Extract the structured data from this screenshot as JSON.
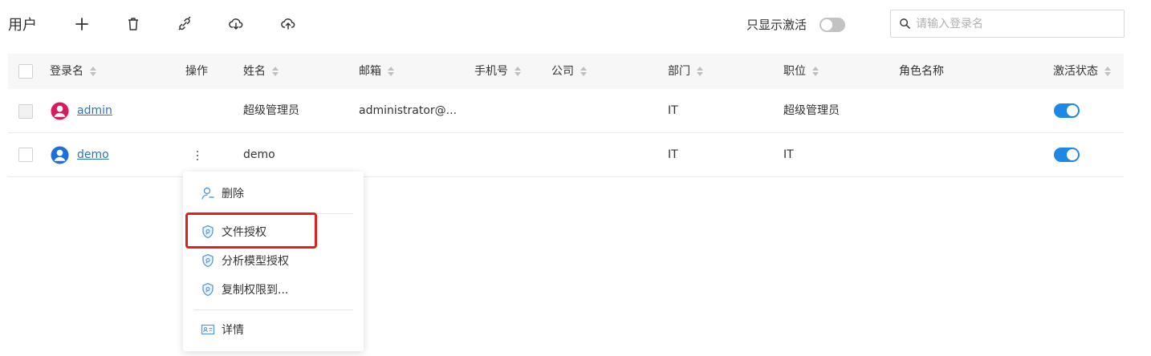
{
  "toolbar": {
    "title": "用户",
    "buttons": [
      {
        "name": "add-button",
        "icon": "plus-icon"
      },
      {
        "name": "delete-button",
        "icon": "trash-icon"
      },
      {
        "name": "link-button",
        "icon": "link-icon"
      },
      {
        "name": "download-button",
        "icon": "cloud-download-icon"
      },
      {
        "name": "upload-button",
        "icon": "cloud-upload-icon"
      }
    ],
    "only_active_label": "只显示激活",
    "only_active_on": false,
    "search_placeholder": "请输入登录名",
    "search_value": ""
  },
  "table": {
    "columns": {
      "login": "登录名",
      "actions": "操作",
      "name": "姓名",
      "email": "邮箱",
      "phone": "手机号",
      "company": "公司",
      "dept": "部门",
      "position": "职位",
      "role": "角色名称",
      "active": "激活状态"
    },
    "rows": [
      {
        "login": "admin",
        "avatar_color": "#d81b60",
        "name": "超级管理员",
        "email": "administrator@...",
        "phone": "",
        "company": "",
        "dept": "IT",
        "position": "超级管理员",
        "role": "",
        "active": true
      },
      {
        "login": "demo",
        "avatar_color": "#1e6fd9",
        "name": "demo",
        "email": "",
        "phone": "",
        "company": "",
        "dept": "IT",
        "position": "IT",
        "role": "",
        "active": true
      }
    ]
  },
  "context_menu": {
    "items": [
      {
        "label": "删除",
        "icon": "user-icon"
      },
      {
        "label": "文件授权",
        "icon": "shield-icon",
        "highlighted": true
      },
      {
        "label": "分析模型授权",
        "icon": "shield-icon"
      },
      {
        "label": "复制权限到...",
        "icon": "shield-icon"
      },
      {
        "label": "详情",
        "icon": "id-card-icon"
      }
    ]
  },
  "colors": {
    "accent": "#1e88e5",
    "link": "#2e74b5",
    "highlight": "#e02020",
    "icon_blue": "#5b9bd5"
  }
}
